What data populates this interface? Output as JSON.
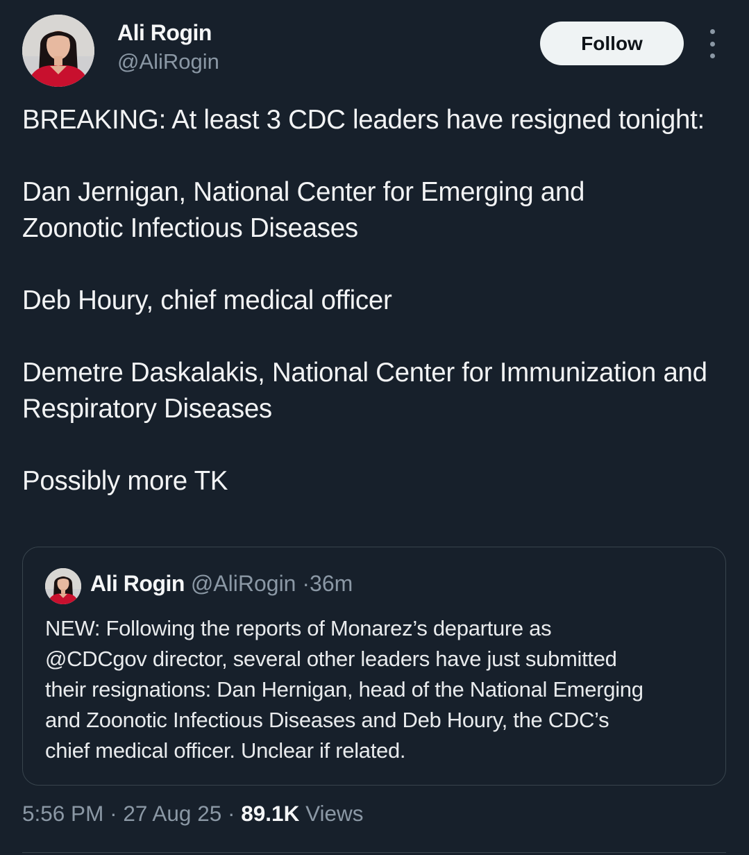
{
  "author": {
    "name": "Ali Rogin",
    "handle": "@AliRogin",
    "avatar_icon": "profile-photo"
  },
  "actions": {
    "follow_label": "Follow",
    "more_icon": "more-vertical-icon"
  },
  "tweet": {
    "paragraphs": [
      "BREAKING: At least 3 CDC leaders have resigned tonight:",
      "Dan Jernigan, National Center for Emerging and Zoonotic Infectious Diseases",
      "Deb Houry, chief medical officer",
      "Demetre Daskalakis, National Center for Immunization and Respiratory Diseases",
      "Possibly more TK"
    ]
  },
  "quote": {
    "name": "Ali Rogin",
    "handle": "@AliRogin",
    "separator": "·",
    "time": "36m",
    "lines": [
      "NEW: Following the reports of Monarez’s departure as",
      "@CDCgov director, several other leaders have just submitted",
      "their resignations: Dan Hernigan, head of the National Emerging",
      "and Zoonotic Infectious Diseases and Deb Houry, the CDC’s",
      "chief medical officer. Unclear if related."
    ]
  },
  "meta": {
    "time": "5:56 PM",
    "date": "27 Aug 25",
    "separator": "·",
    "views_count": "89.1K",
    "views_label": "Views"
  },
  "colors": {
    "background": "#17202b",
    "text": "#f2f3f4",
    "muted": "#8b98a5",
    "border": "#38444d",
    "avatar_dress": "#c8102e"
  }
}
